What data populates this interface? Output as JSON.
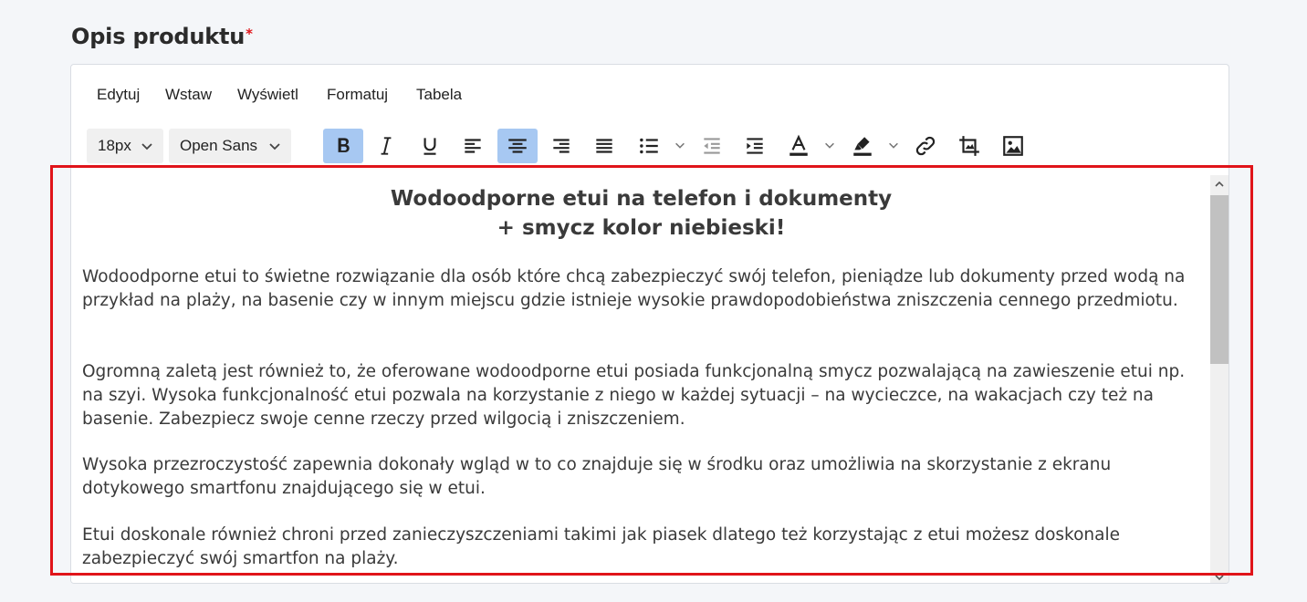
{
  "section": {
    "title": "Opis produktu",
    "required_mark": "*"
  },
  "menu": {
    "items": [
      "Edytuj",
      "Wstaw",
      "Wyświetl",
      "Formatuj",
      "Tabela"
    ]
  },
  "toolbar": {
    "font_size": "18px",
    "font_family": "Open Sans",
    "buttons": [
      "bold-icon",
      "italic-icon",
      "underline-icon",
      "align-left-icon",
      "align-center-icon",
      "align-right-icon",
      "align-justify-icon",
      "bullet-list-icon",
      "outdent-icon",
      "indent-icon",
      "text-color-icon",
      "highlight-color-icon",
      "link-icon",
      "crop-image-icon",
      "image-icon"
    ],
    "active": [
      "bold",
      "align-center"
    ]
  },
  "content": {
    "heading_line1": "Wodoodporne etui na telefon i dokumenty",
    "heading_line2": "+ smycz kolor niebieski!",
    "paragraphs": [
      "Wodoodporne etui to świetne rozwiązanie dla osób które chcą zabezpieczyć swój telefon, pieniądze lub dokumenty przed wodą na przykład na plaży, na basenie czy w innym miejscu gdzie istnieje wysokie prawdopodobieństwa zniszczenia cennego przedmiotu.",
      "Ogromną zaletą jest również to, że oferowane wodoodporne etui posiada funkcjonalną smycz pozwalającą na zawieszenie etui np. na szyi. Wysoka funkcjonalność etui pozwala na korzystanie z niego w każdej sytuacji – na wycieczce, na wakacjach czy też na basenie. Zabezpiecz swoje cenne rzeczy przed wilgocią i zniszczeniem.",
      "Wysoka przezroczystość zapewnia dokonały wgląd w to co znajduje się w środku oraz umożliwia na skorzystanie z ekranu dotykowego smartfonu znajdującego się w etui.",
      "Etui doskonale również chroni przed zanieczyszczeniami takimi jak piasek dlatego też korzystając z etui możesz doskonale zabezpieczyć swój smartfon na plaży."
    ]
  },
  "colors": {
    "active_button": "#a7c8f2",
    "required": "#e0161b",
    "highlight_border": "#e0141a"
  }
}
